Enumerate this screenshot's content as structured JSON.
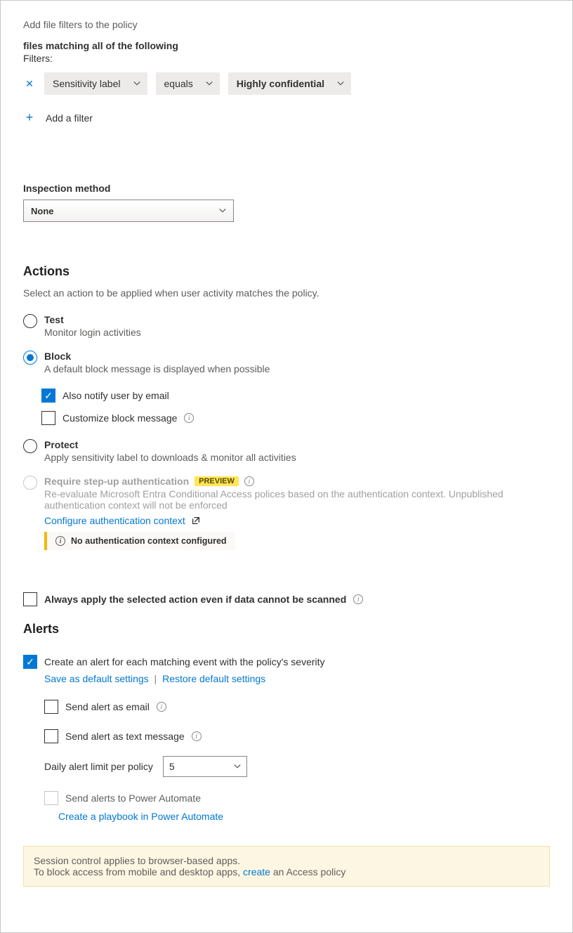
{
  "header": {
    "description": "Add file filters to the policy"
  },
  "filters": {
    "title": "files matching all of the following",
    "label": "Filters:",
    "row": {
      "field": "Sensitivity label",
      "operator": "equals",
      "value": "Highly confidential"
    },
    "add_label": "Add a filter"
  },
  "inspection": {
    "label": "Inspection method",
    "value": "None"
  },
  "actions": {
    "heading": "Actions",
    "description": "Select an action to be applied when user activity matches the policy.",
    "test": {
      "title": "Test",
      "desc": "Monitor login activities"
    },
    "block": {
      "title": "Block",
      "desc": "A default block message is displayed when possible",
      "notify_email": "Also notify user by email",
      "customize": "Customize block message"
    },
    "protect": {
      "title": "Protect",
      "desc": "Apply sensitivity label to downloads & monitor all activities"
    },
    "stepup": {
      "title": "Require step-up authentication",
      "badge": "PREVIEW",
      "desc": "Re-evaluate Microsoft Entra Conditional Access polices based on the authentication context. Unpublished authentication context will not be enforced",
      "configure": "Configure authentication context",
      "warn": "No authentication context configured"
    },
    "always_apply": "Always apply the selected action even if data cannot be scanned"
  },
  "alerts": {
    "heading": "Alerts",
    "create_alert": "Create an alert for each matching event with the policy's severity",
    "save_default": "Save as default settings",
    "restore_default": "Restore default settings",
    "send_email": "Send alert as email",
    "send_text": "Send alert as text message",
    "daily_limit_label": "Daily alert limit per policy",
    "daily_limit_value": "5",
    "power_automate": "Send alerts to Power Automate",
    "create_playbook": "Create a playbook in Power Automate"
  },
  "footer": {
    "line1": "Session control applies to browser-based apps.",
    "line2a": "To block access from mobile and desktop apps, ",
    "line2_link": "create",
    "line2b": " an Access policy"
  }
}
